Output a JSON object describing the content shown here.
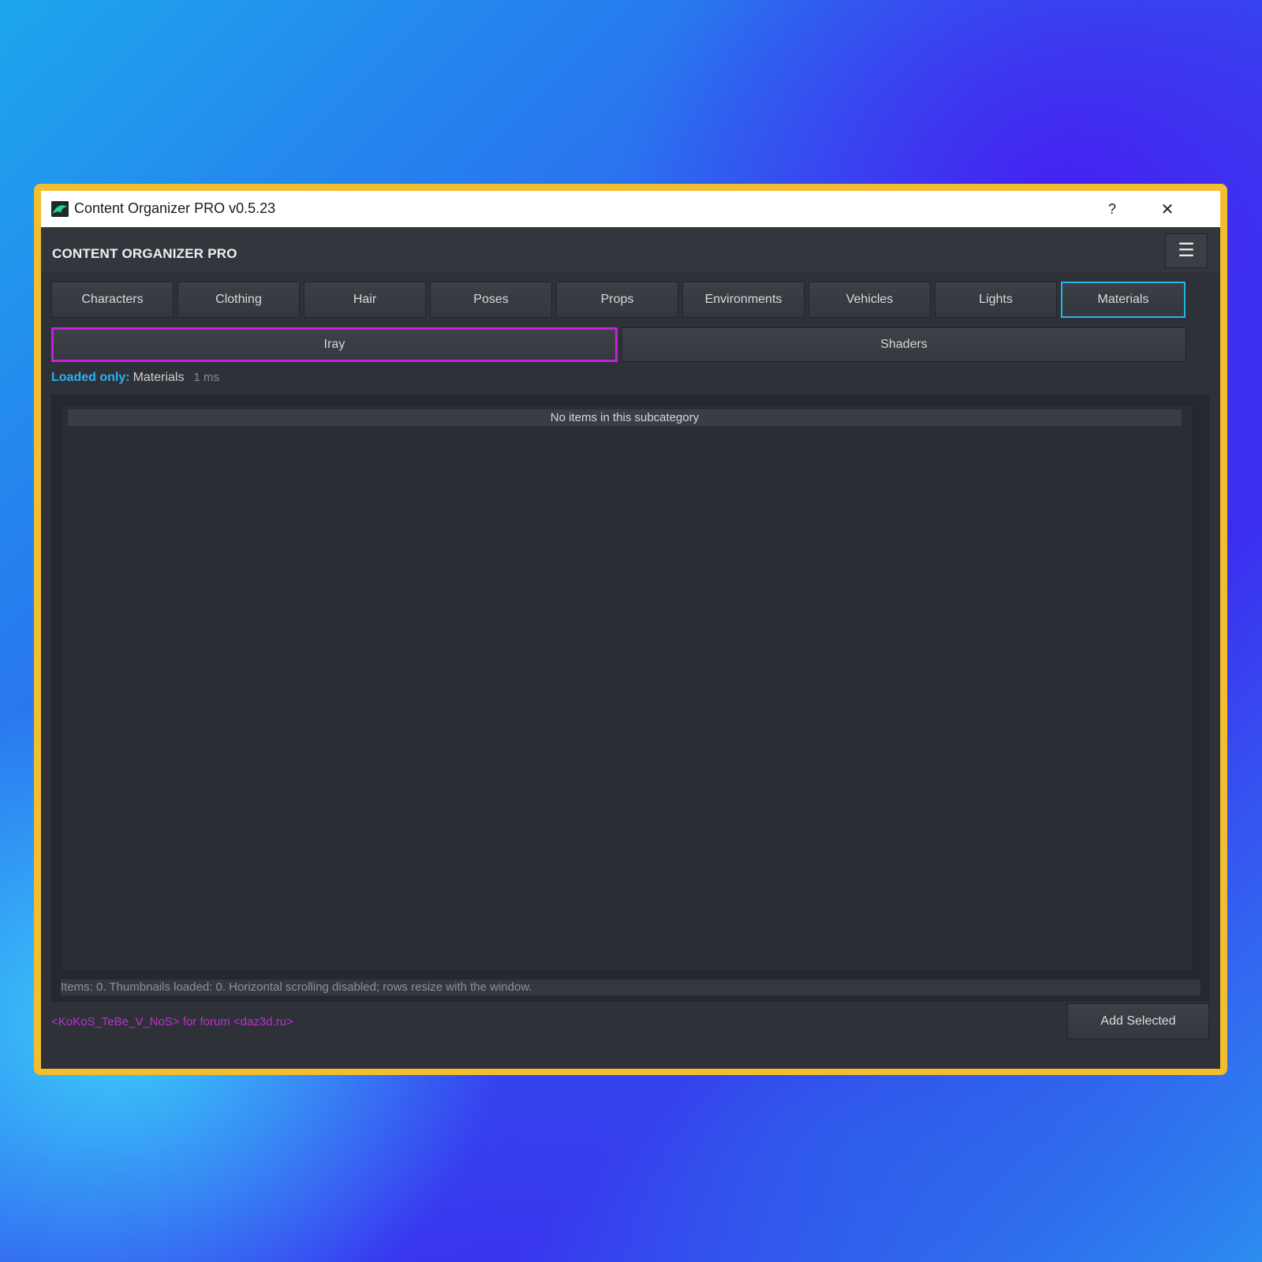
{
  "window": {
    "title": "Content Organizer PRO v0.5.23",
    "help_glyph": "?",
    "close_glyph": "✕"
  },
  "header": {
    "app_name": "CONTENT ORGANIZER PRO",
    "menu_glyph": "☰"
  },
  "tabs": [
    {
      "label": "Characters"
    },
    {
      "label": "Clothing"
    },
    {
      "label": "Hair"
    },
    {
      "label": "Poses"
    },
    {
      "label": "Props"
    },
    {
      "label": "Environments"
    },
    {
      "label": "Vehicles"
    },
    {
      "label": "Lights"
    },
    {
      "label": "Materials",
      "active": true
    }
  ],
  "subtabs": [
    {
      "label": "Iray",
      "active": true
    },
    {
      "label": "Shaders"
    }
  ],
  "status": {
    "loaded_label": "Loaded only:",
    "loaded_value": "Materials",
    "time": "1 ms"
  },
  "list": {
    "empty_message": "No items in this subcategory",
    "footer": "Items: 0. Thumbnails loaded: 0. Horizontal scrolling disabled; rows resize with the window."
  },
  "credit": "<KoKoS_TeBe_V_NoS> for forum <daz3d.ru>",
  "actions": {
    "add_selected": "Add Selected"
  },
  "colors": {
    "frame": "#f2bd2e",
    "active_tab_border": "#22b6ea",
    "active_subtab_border": "#c61fdc",
    "loaded_label": "#29b3ee",
    "credit": "#c22bd8"
  }
}
